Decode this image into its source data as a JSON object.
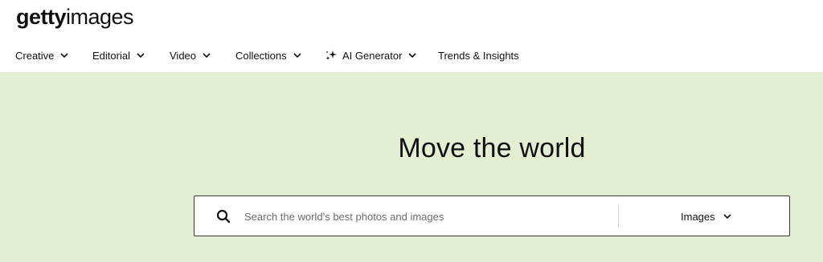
{
  "brand": {
    "logo_bold": "getty",
    "logo_light": "images"
  },
  "nav": {
    "items": [
      {
        "label": "Creative",
        "has_dropdown": true
      },
      {
        "label": "Editorial",
        "has_dropdown": true
      },
      {
        "label": "Video",
        "has_dropdown": true
      },
      {
        "label": "Collections",
        "has_dropdown": true
      },
      {
        "label": "AI Generator",
        "has_dropdown": true,
        "icon": "sparkle-icon"
      },
      {
        "label": "Trends & Insights",
        "has_dropdown": false
      }
    ]
  },
  "hero": {
    "headline": "Move the world",
    "background_color": "#e2efd3"
  },
  "search": {
    "placeholder": "Search the world’s best photos and images",
    "value": "",
    "icon": "search-icon",
    "type_selected": "Images"
  }
}
